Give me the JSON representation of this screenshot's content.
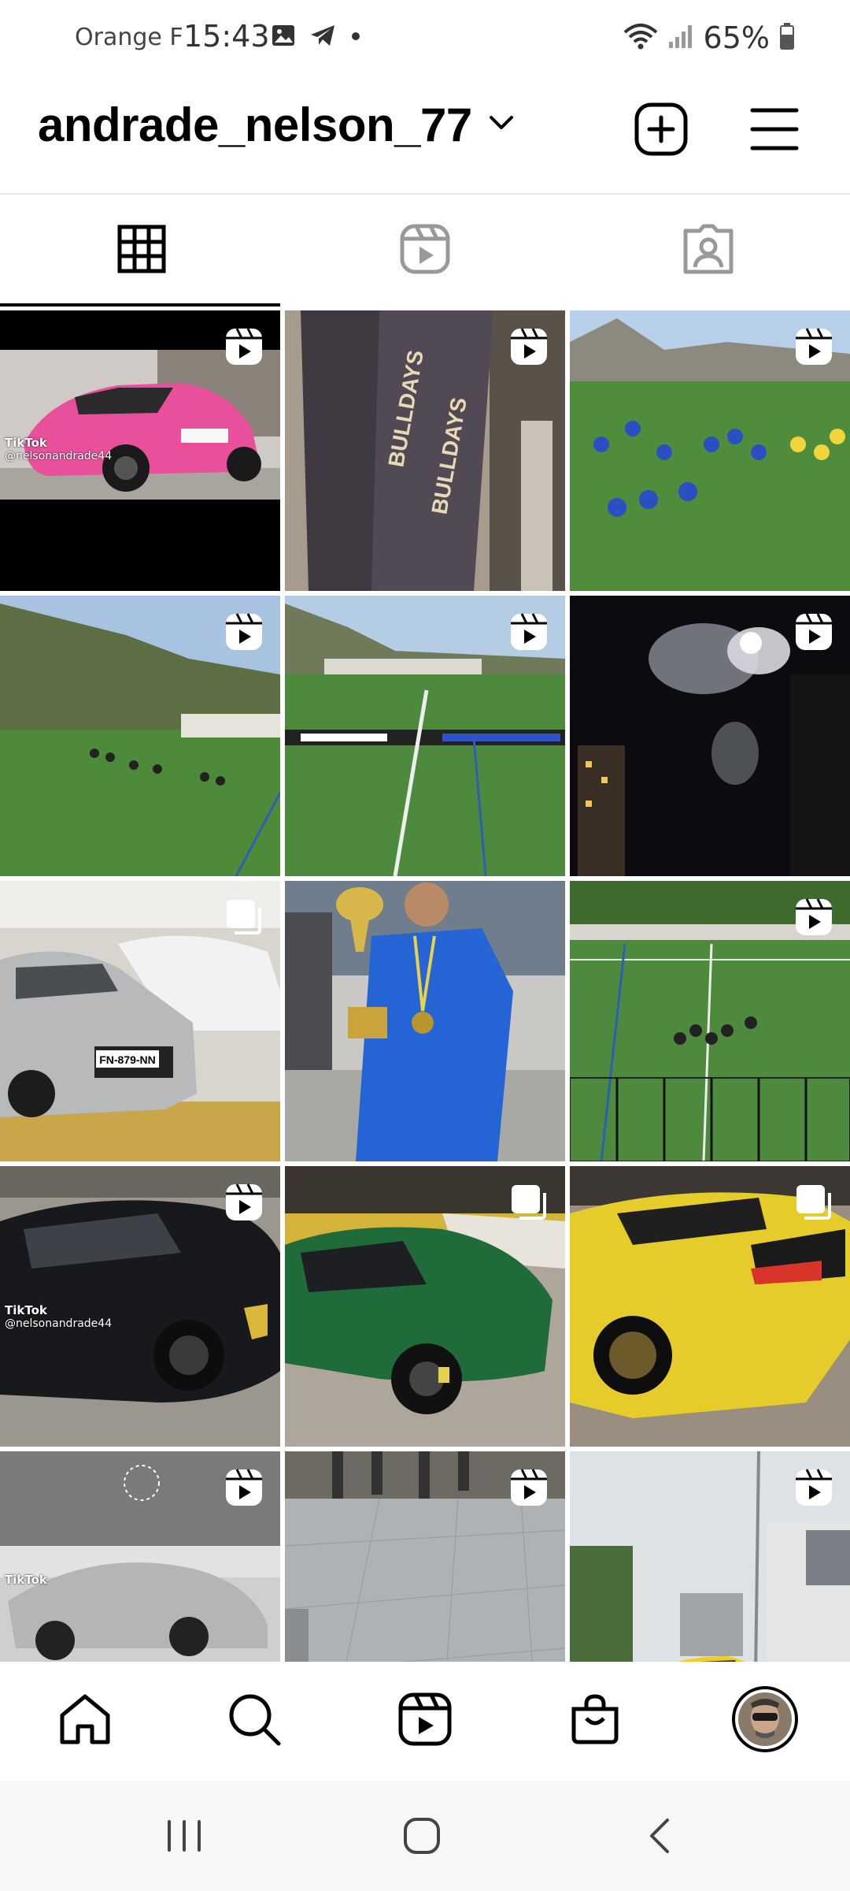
{
  "status_bar": {
    "carrier": "Orange F",
    "time": "15:43",
    "battery": "65%",
    "icons_left": [
      "gallery-icon",
      "telegram-icon",
      "dot-icon"
    ],
    "icons_right": [
      "wifi-icon",
      "signal-icon",
      "battery-icon"
    ]
  },
  "header": {
    "username": "andrade_nelson_77",
    "dropdown_icon": "chevron-down-icon",
    "add_icon": "plus-square-icon",
    "menu_icon": "hamburger-icon"
  },
  "tabs": [
    {
      "name": "grid",
      "icon": "grid-icon",
      "active": true
    },
    {
      "name": "reels",
      "icon": "reels-icon",
      "active": false
    },
    {
      "name": "tagged",
      "icon": "tagged-icon",
      "active": false
    }
  ],
  "posts": [
    {
      "type": "reel",
      "watermark": {
        "brand": "TikTok",
        "handle": "@nelsonandrade44"
      }
    },
    {
      "type": "reel",
      "banner_text": "BULLDAYS"
    },
    {
      "type": "reel"
    },
    {
      "type": "reel"
    },
    {
      "type": "reel"
    },
    {
      "type": "reel"
    },
    {
      "type": "carousel",
      "plate": "FN-879-NN"
    },
    {
      "type": "photo"
    },
    {
      "type": "reel"
    },
    {
      "type": "reel",
      "watermark": {
        "brand": "TikTok",
        "handle": "@nelsonandrade44"
      }
    },
    {
      "type": "carousel"
    },
    {
      "type": "carousel"
    },
    {
      "type": "reel",
      "watermark": {
        "brand": "TikTok",
        "handle": ""
      }
    },
    {
      "type": "reel"
    },
    {
      "type": "reel"
    }
  ],
  "bottom_nav": [
    "home-icon",
    "search-icon",
    "reels-icon",
    "shop-icon",
    "profile-avatar"
  ],
  "system_nav": [
    "recents-icon",
    "home-button-icon",
    "back-icon"
  ]
}
